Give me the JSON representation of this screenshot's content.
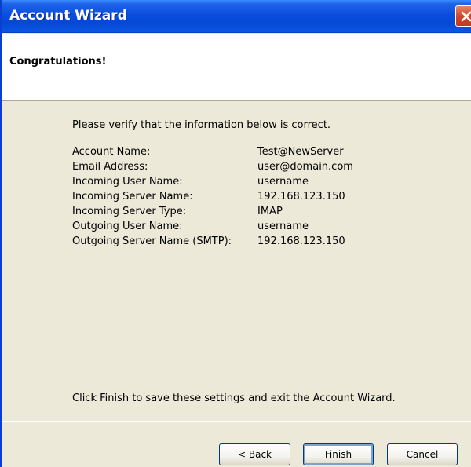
{
  "window": {
    "title": "Account Wizard"
  },
  "header": {
    "title": "Congratulations!"
  },
  "content": {
    "intro": "Please verify that the information below is correct.",
    "rows": [
      {
        "label": "Account Name:",
        "value": "Test@NewServer"
      },
      {
        "label": "Email Address:",
        "value": "user@domain.com"
      },
      {
        "label": "Incoming User Name:",
        "value": "username"
      },
      {
        "label": "Incoming Server Name:",
        "value": "192.168.123.150"
      },
      {
        "label": "Incoming Server Type:",
        "value": "IMAP"
      },
      {
        "label": "Outgoing User Name:",
        "value": "username"
      },
      {
        "label": "Outgoing Server Name (SMTP):",
        "value": "192.168.123.150"
      }
    ],
    "footer": "Click Finish to save these settings and exit the Account Wizard."
  },
  "buttons": {
    "back": "< Back",
    "finish": "Finish",
    "cancel": "Cancel"
  },
  "icons": {
    "close": "close-icon"
  },
  "colors": {
    "titlebar": "#0a4ee0",
    "close_button": "#d2462a",
    "dialog_bg": "#ece9d8"
  }
}
